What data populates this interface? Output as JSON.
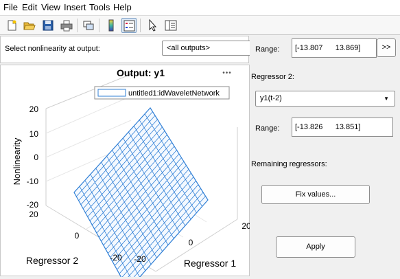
{
  "menu": [
    "File",
    "Edit",
    "View",
    "Insert",
    "Tools",
    "Help"
  ],
  "toolbar": {
    "icons": [
      "new-file-icon",
      "open-folder-icon",
      "save-icon",
      "print-icon",
      "link-plot-icon",
      "colorbar-icon",
      "legend-icon",
      "pointer-icon",
      "property-editor-icon"
    ]
  },
  "nonlinearity": {
    "label": "Select nonlinearity at output:",
    "selected": "<all outputs>"
  },
  "plot": {
    "title": "Output: y1",
    "legend": "untitled1:idWaveletNetwork",
    "zlabel": "Nonlinearity",
    "xlabel": "Regressor 1",
    "ylabel": "Regressor 2",
    "zticks": [
      "20",
      "10",
      "0",
      "-10",
      "-20"
    ],
    "xticks": [
      "-20",
      "0",
      "20"
    ],
    "yticks": [
      "20",
      "0",
      "-20"
    ],
    "more": "•••",
    "color": "#2f7fd6"
  },
  "chart_data": {
    "type": "surface",
    "title": "Output: y1",
    "xlabel": "Regressor 1",
    "ylabel": "Regressor 2",
    "zlabel": "Nonlinearity",
    "xlim": [
      -20,
      20
    ],
    "ylim": [
      -20,
      20
    ],
    "zlim": [
      -20,
      20
    ],
    "x_range": [
      -13.807,
      13.869
    ],
    "y_range": [
      -13.826,
      13.851
    ],
    "legend": [
      "untitled1:idWaveletNetwork"
    ],
    "grid": true
  },
  "right": {
    "range1_label": "Range:",
    "range1_value": "[-13.807      13.869]",
    "range1_button": ">>",
    "reg2_label": "Regressor 2:",
    "reg2_selected": "y1(t-2)",
    "range2_label": "Range:",
    "range2_value": "[-13.826      13.851]",
    "remaining_label": "Remaining regressors:",
    "fix_button": "Fix values...",
    "apply_button": "Apply"
  }
}
